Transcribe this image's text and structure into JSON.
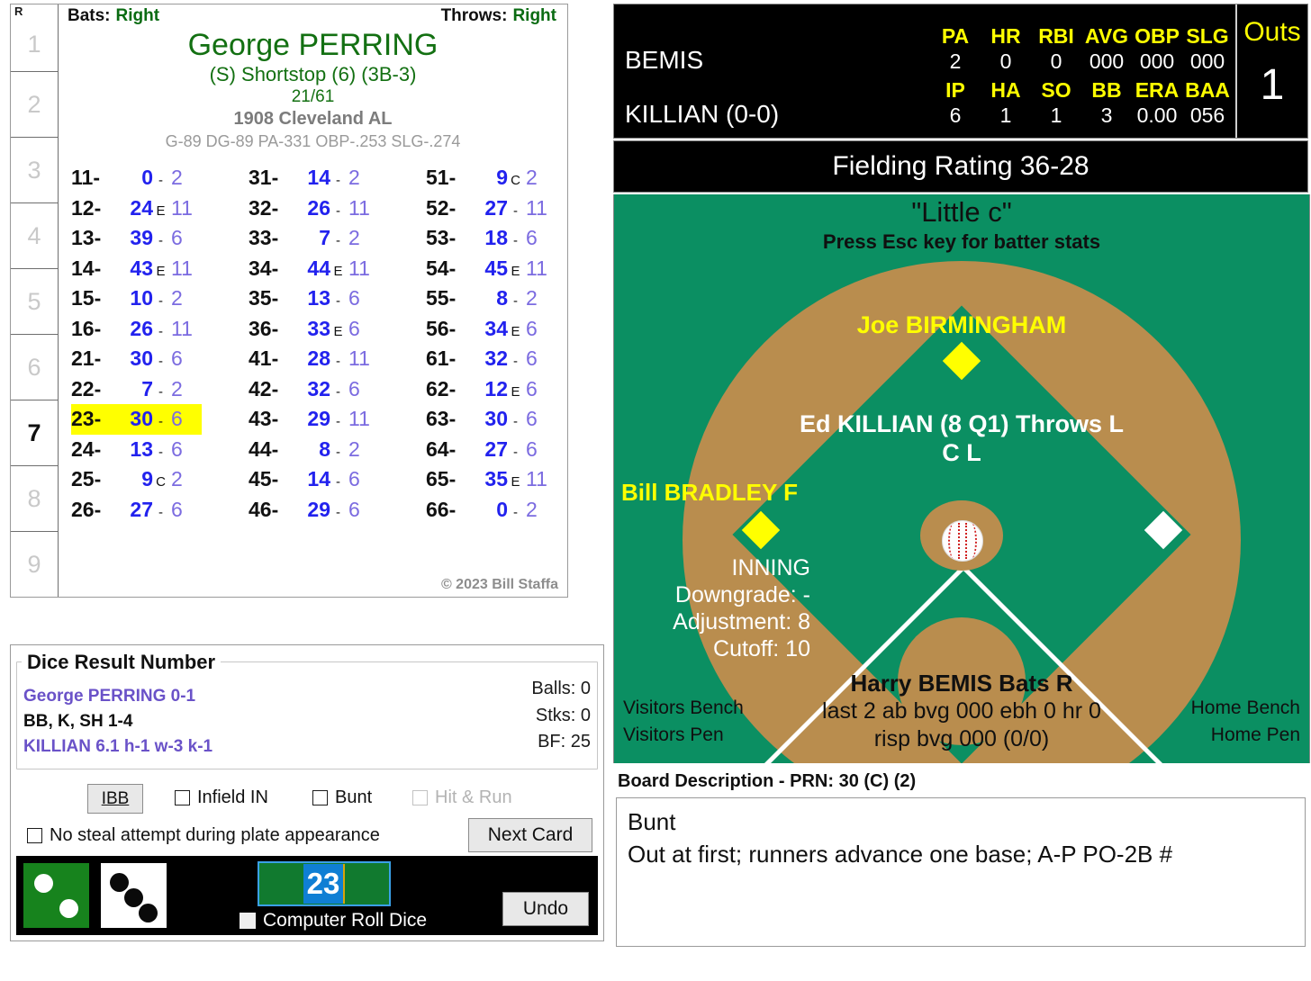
{
  "player_card": {
    "inning_header": "R",
    "innings": [
      "1",
      "2",
      "3",
      "4",
      "5",
      "6",
      "7",
      "8",
      "9"
    ],
    "current_inning": "7",
    "bats_label": "Bats:",
    "bats_value": "Right",
    "throws_label": "Throws:",
    "throws_value": "Right",
    "name": "George PERRING",
    "position": "(S) Shortstop (6) (3B-3)",
    "number": "21/61",
    "team": "1908 Cleveland AL",
    "stats": "G-89 DG-89 PA-331 OBP-.253 SLG-.274",
    "copyright": "© 2023 Bill Staffa",
    "highlighted_roll": "23",
    "dice_table": {
      "col1": [
        {
          "id": "11-",
          "val": "0",
          "mark": "-",
          "suf": "2"
        },
        {
          "id": "12-",
          "val": "24",
          "mark": "E",
          "suf": "11"
        },
        {
          "id": "13-",
          "val": "39",
          "mark": "-",
          "suf": "6"
        },
        {
          "id": "14-",
          "val": "43",
          "mark": "E",
          "suf": "11"
        },
        {
          "id": "15-",
          "val": "10",
          "mark": "-",
          "suf": "2"
        },
        {
          "id": "16-",
          "val": "26",
          "mark": "-",
          "suf": "11"
        },
        {
          "id": "21-",
          "val": "30",
          "mark": "-",
          "suf": "6"
        },
        {
          "id": "22-",
          "val": "7",
          "mark": "-",
          "suf": "2"
        },
        {
          "id": "23-",
          "val": "30",
          "mark": "-",
          "suf": "6",
          "highlight": true
        },
        {
          "id": "24-",
          "val": "13",
          "mark": "-",
          "suf": "6"
        },
        {
          "id": "25-",
          "val": "9",
          "mark": "C",
          "suf": "2"
        },
        {
          "id": "26-",
          "val": "27",
          "mark": "-",
          "suf": "6"
        }
      ],
      "col2": [
        {
          "id": "31-",
          "val": "14",
          "mark": "-",
          "suf": "2"
        },
        {
          "id": "32-",
          "val": "26",
          "mark": "-",
          "suf": "11"
        },
        {
          "id": "33-",
          "val": "7",
          "mark": "-",
          "suf": "2"
        },
        {
          "id": "34-",
          "val": "44",
          "mark": "E",
          "suf": "11"
        },
        {
          "id": "35-",
          "val": "13",
          "mark": "-",
          "suf": "6"
        },
        {
          "id": "36-",
          "val": "33",
          "mark": "E",
          "suf": "6"
        },
        {
          "id": "41-",
          "val": "28",
          "mark": "-",
          "suf": "11"
        },
        {
          "id": "42-",
          "val": "32",
          "mark": "-",
          "suf": "6"
        },
        {
          "id": "43-",
          "val": "29",
          "mark": "-",
          "suf": "11"
        },
        {
          "id": "44-",
          "val": "8",
          "mark": "-",
          "suf": "2"
        },
        {
          "id": "45-",
          "val": "14",
          "mark": "-",
          "suf": "6"
        },
        {
          "id": "46-",
          "val": "29",
          "mark": "-",
          "suf": "6"
        }
      ],
      "col3": [
        {
          "id": "51-",
          "val": "9",
          "mark": "C",
          "suf": "2"
        },
        {
          "id": "52-",
          "val": "27",
          "mark": "-",
          "suf": "11"
        },
        {
          "id": "53-",
          "val": "18",
          "mark": "-",
          "suf": "6"
        },
        {
          "id": "54-",
          "val": "45",
          "mark": "E",
          "suf": "11"
        },
        {
          "id": "55-",
          "val": "8",
          "mark": "-",
          "suf": "2"
        },
        {
          "id": "56-",
          "val": "34",
          "mark": "E",
          "suf": "6"
        },
        {
          "id": "61-",
          "val": "32",
          "mark": "-",
          "suf": "6"
        },
        {
          "id": "62-",
          "val": "12",
          "mark": "E",
          "suf": "6"
        },
        {
          "id": "63-",
          "val": "30",
          "mark": "-",
          "suf": "6"
        },
        {
          "id": "64-",
          "val": "27",
          "mark": "-",
          "suf": "6"
        },
        {
          "id": "65-",
          "val": "35",
          "mark": "E",
          "suf": "11"
        },
        {
          "id": "66-",
          "val": "0",
          "mark": "-",
          "suf": "2"
        }
      ]
    }
  },
  "dice_panel": {
    "title": "Dice Result Number",
    "batter_line": "George PERRING  0-1",
    "bbk_line": "BB, K, SH 1-4",
    "pitcher_line": "KILLIAN  6.1  h-1  w-3  k-1",
    "balls": "Balls: 0",
    "strikes": "Stks: 0",
    "bf": "BF: 25",
    "ibb_button": "IBB",
    "infield_in": "Infield IN",
    "bunt": "Bunt",
    "hit_and_run": "Hit & Run",
    "no_steal": "No steal attempt during plate appearance",
    "next_card": "Next Card",
    "computer_roll": "Computer Roll Dice",
    "undo": "Undo",
    "roll_value": "23",
    "green_die": 2,
    "white_die": 3
  },
  "scoreboard": {
    "batter_name": "BEMIS",
    "pitcher_name": "KILLIAN (0-0)",
    "batter_headers": [
      "PA",
      "HR",
      "RBI",
      "AVG",
      "OBP",
      "SLG"
    ],
    "batter_values": [
      "2",
      "0",
      "0",
      "000",
      "000",
      "000"
    ],
    "pitcher_headers": [
      "IP",
      "HA",
      "SO",
      "BB",
      "ERA",
      "BAA"
    ],
    "pitcher_values": [
      "6",
      "1",
      "1",
      "3",
      "0.00",
      "056"
    ],
    "outs_label": "Outs",
    "outs_value": "1"
  },
  "field": {
    "fielding_rating": "Fielding Rating 36-28",
    "little_c": "\"Little c\"",
    "esc_hint": "Press Esc key for batter stats",
    "centerfielder": "Joe BIRMINGHAM",
    "pitcher": "Ed KILLIAN (8 Q1) Throws L",
    "pitcher_sub": "C L",
    "thirdbase": "Bill BRADLEY F",
    "inning_label": "INNING",
    "downgrade": "Downgrade: -",
    "adjustment": "Adjustment: 8",
    "cutoff": "Cutoff: 10",
    "batter_name": "Harry BEMIS Bats R",
    "batter_line2": "last 2 ab bvg 000 ebh 0 hr 0",
    "batter_line3": "risp bvg 000 (0/0)",
    "visitors_bench": "Visitors Bench",
    "visitors_pen": "Visitors Pen",
    "home_bench": "Home Bench",
    "home_pen": "Home Pen"
  },
  "board_description": {
    "label": "Board Description - PRN: 30 (C) (2)",
    "line1": "Bunt",
    "line2": "Out at first; runners advance one base; A-P PO-2B #"
  },
  "colors": {
    "grass": "#0b8f62",
    "dirt": "#b98d4e",
    "highlight": "#ffff00",
    "card_green": "#137012",
    "dice_blue": "#2222ee",
    "dice_purple": "#7b6be0"
  }
}
